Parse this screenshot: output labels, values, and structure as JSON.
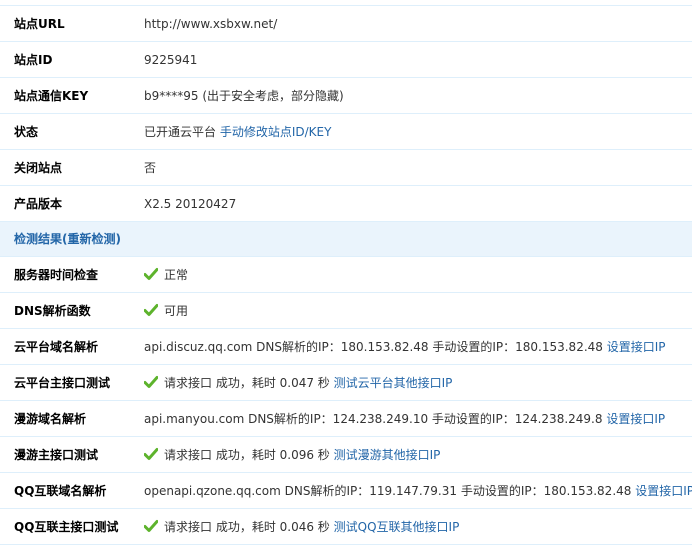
{
  "rows_info": [
    {
      "label": "站点URL",
      "value": "http://www.xsbxw.net/"
    },
    {
      "label": "站点ID",
      "value": "9225941"
    },
    {
      "label": "站点通信KEY",
      "value": "b9****95 (出于安全考虑，部分隐藏)"
    },
    {
      "label": "状态",
      "value": "已开通云平台",
      "link": "手动修改站点ID/KEY"
    },
    {
      "label": "关闭站点",
      "value": "否"
    },
    {
      "label": "产品版本",
      "value": "X2.5 20120427"
    }
  ],
  "section": {
    "title": "检测结果",
    "link": "(重新检测)"
  },
  "rows_check": [
    {
      "label": "服务器时间检查",
      "value": "正常",
      "icon": "check-icon",
      "icon_color": "#5db32c"
    },
    {
      "label": "DNS解析函数",
      "value": "可用",
      "icon": "check-icon",
      "icon_color": "#5db32c"
    },
    {
      "label": "云平台域名解析",
      "value": "api.discuz.qq.com DNS解析的IP：180.153.82.48 手动设置的IP：180.153.82.48",
      "link": "设置接口IP"
    },
    {
      "label": "云平台主接口测试",
      "value": "请求接口 成功，耗时 0.047 秒",
      "icon": "check-icon",
      "link": "测试云平台其他接口IP"
    },
    {
      "label": "漫游域名解析",
      "value": "api.manyou.com DNS解析的IP：124.238.249.10 手动设置的IP：124.238.249.8",
      "link": "设置接口IP"
    },
    {
      "label": "漫游主接口测试",
      "value": "请求接口 成功，耗时 0.096 秒",
      "icon": "check-icon",
      "link": "测试漫游其他接口IP"
    },
    {
      "label": "QQ互联域名解析",
      "value": "openapi.qzone.qq.com DNS解析的IP：119.147.79.31 手动设置的IP：180.153.82.48",
      "link": "设置接口IP"
    },
    {
      "label": "QQ互联主接口测试",
      "value": "请求接口 成功，耗时 0.046 秒",
      "icon": "check-icon",
      "link": "测试QQ互联其他接口IP"
    }
  ],
  "colors": {
    "link": "#2366a8",
    "section_bg": "#eaf4fc",
    "border": "#deeffb"
  }
}
